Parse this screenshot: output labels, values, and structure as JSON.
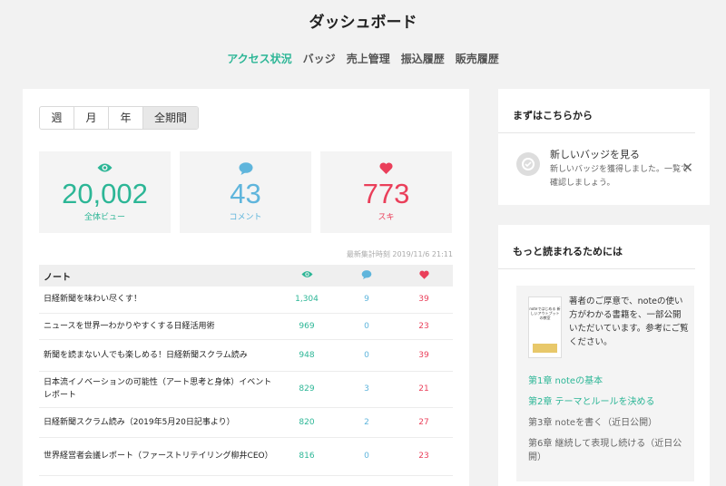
{
  "page": {
    "title": "ダッシュボード"
  },
  "nav": [
    "アクセス状況",
    "バッジ",
    "売上管理",
    "振込履歴",
    "販売履歴"
  ],
  "periods": [
    "週",
    "月",
    "年",
    "全期間"
  ],
  "stats": {
    "views": {
      "value": "20,002",
      "label": "全体ビュー"
    },
    "comments": {
      "value": "43",
      "label": "コメント"
    },
    "likes": {
      "value": "773",
      "label": "スキ"
    }
  },
  "updated": "最新集計時刻 2019/11/6 21:11",
  "table": {
    "header": "ノート",
    "rows": [
      {
        "title": "日経新聞を味わい尽くす！",
        "views": "1,304",
        "comments": "9",
        "likes": "39"
      },
      {
        "title": "ニュースを世界一わかりやすくする日経活用術",
        "views": "969",
        "comments": "0",
        "likes": "23"
      },
      {
        "title": "新聞を読まない人でも楽しめる！日経新聞スクラム読み",
        "views": "948",
        "comments": "0",
        "likes": "39"
      },
      {
        "title": "日本流イノベーションの可能性（アート思考と身体）イベントレポート",
        "views": "829",
        "comments": "3",
        "likes": "21"
      },
      {
        "title": "日経新聞スクラム読み（2019年5月20日記事より）",
        "views": "820",
        "comments": "2",
        "likes": "27"
      },
      {
        "title": "世界経営者会議レポート（ファーストリテイリング柳井CEO）",
        "views": "816",
        "comments": "0",
        "likes": "23"
      }
    ]
  },
  "sidebar": {
    "start": {
      "heading": "まずはこちらから",
      "notice_title": "新しいバッジを見る",
      "notice_body": "新しいバッジを獲得しました。一覧で確認しましょう。"
    },
    "more": {
      "heading": "もっと読まれるためには",
      "book_title": "noteではじめる 新しいアウトプットの教室",
      "intro": "著者のご厚意で、noteの使い方がわかる書籍を、一部公開いただいています。参考にご覧ください。",
      "chapters": [
        {
          "label": "第1章 noteの基本",
          "link": true
        },
        {
          "label": "第2章 テーマとルールを決める",
          "link": true
        },
        {
          "label": "第3章 noteを書く（近日公開）",
          "link": false
        },
        {
          "label": "第6章 継続して表現し続ける（近日公開）",
          "link": false
        }
      ]
    }
  },
  "colors": {
    "accent": "#2cb696",
    "comment": "#5fb5dc",
    "like": "#ea3f5a"
  },
  "icons": {
    "view": "eye-icon",
    "comment": "speech-bubble-icon",
    "like": "heart-icon",
    "close": "close-icon",
    "badge": "badge-icon"
  }
}
